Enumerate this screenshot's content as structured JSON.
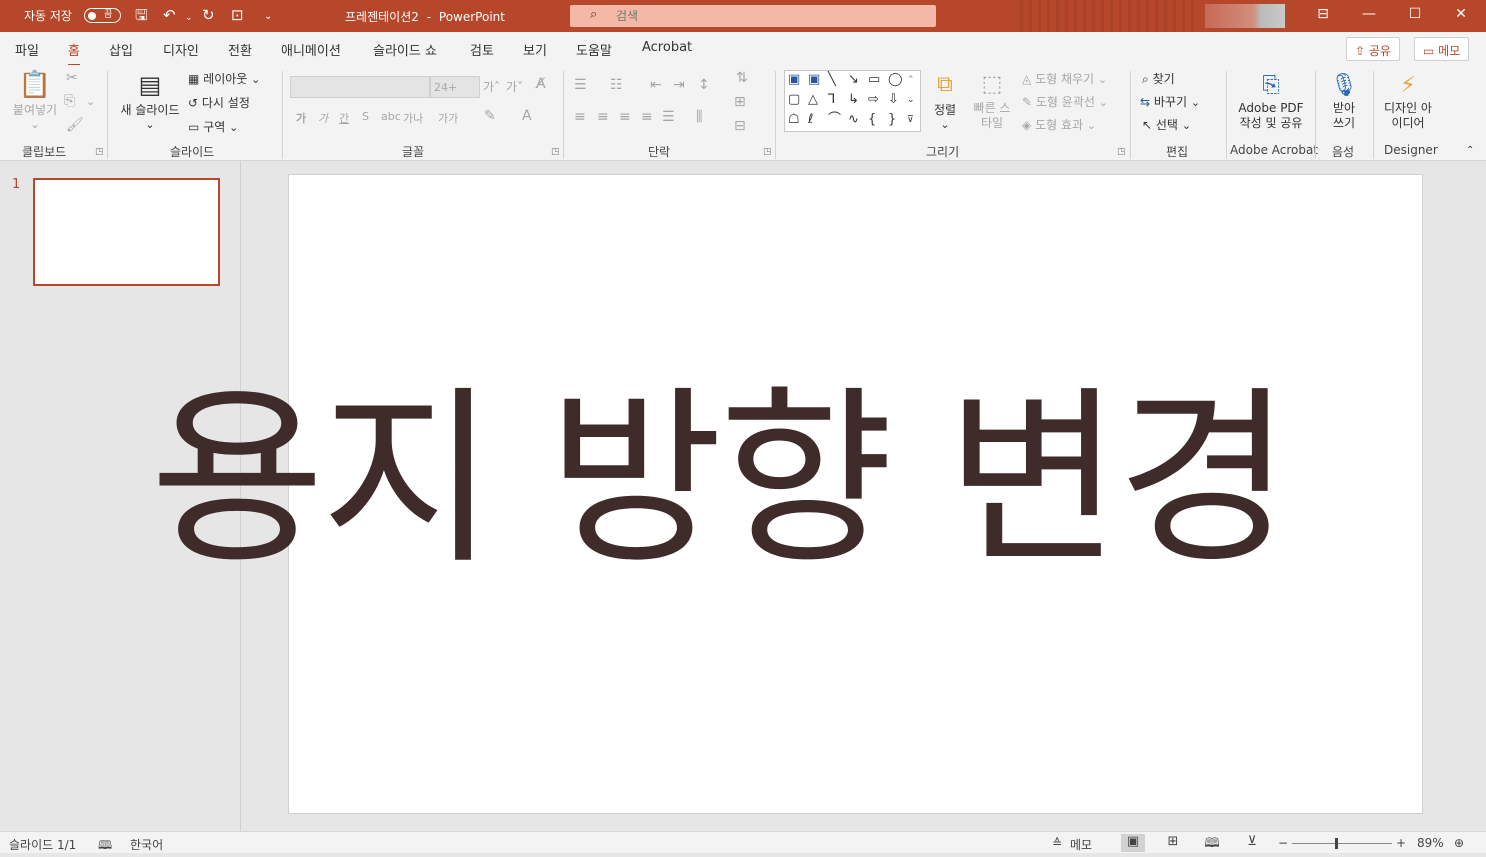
{
  "titlebar": {
    "autosave_label": "자동 저장",
    "autosave_state": "끔",
    "doc_name": "프레젠테이션2",
    "separator": "-",
    "app_name": "PowerPoint",
    "search_placeholder": "검색"
  },
  "tabs": [
    "파일",
    "홈",
    "삽입",
    "디자인",
    "전환",
    "애니메이션",
    "슬라이드 쇼",
    "검토",
    "보기",
    "도움말",
    "Acrobat"
  ],
  "active_tab": "홈",
  "share_label": "공유",
  "memo_btn_label": "메모",
  "ribbon": {
    "clipboard": {
      "paste": "붙여넣기",
      "group": "클립보드"
    },
    "slides": {
      "new_slide": "새 슬라이드",
      "layout": "레이아웃",
      "reset": "다시 설정",
      "section": "구역",
      "group": "슬라이드"
    },
    "font": {
      "size_placeholder": "24+",
      "group": "글꼴",
      "grow": "가˄",
      "shrink": "가˅",
      "bold": "가",
      "italic": "가",
      "underline": "간",
      "strike": "S",
      "spacing": "가나",
      "case": "가가"
    },
    "paragraph": {
      "group": "단락"
    },
    "drawing": {
      "arrange": "정렬",
      "quick_styles": "빠른 스타일",
      "fill": "도형 채우기",
      "outline": "도형 윤곽선",
      "effects": "도형 효과",
      "group": "그리기"
    },
    "editing": {
      "find": "찾기",
      "replace": "바꾸기",
      "select": "선택",
      "group": "편집"
    },
    "acrobat": {
      "create": "Adobe PDF 작성 및 공유",
      "group": "Adobe Acrobat"
    },
    "voice": {
      "dictate": "받아 쓰기",
      "group": "음성"
    },
    "designer": {
      "ideas": "디자인 아이디어",
      "group": "Designer"
    }
  },
  "slides_pane": {
    "slide_number": "1"
  },
  "slide": {
    "title": "용지 방향 변경"
  },
  "status": {
    "slide_info": "슬라이드 1/1",
    "language": "한국어",
    "notes": "메모",
    "zoom": "89%"
  },
  "colors": {
    "accent": "#b7472a",
    "text_dark": "#3e2b2a"
  }
}
